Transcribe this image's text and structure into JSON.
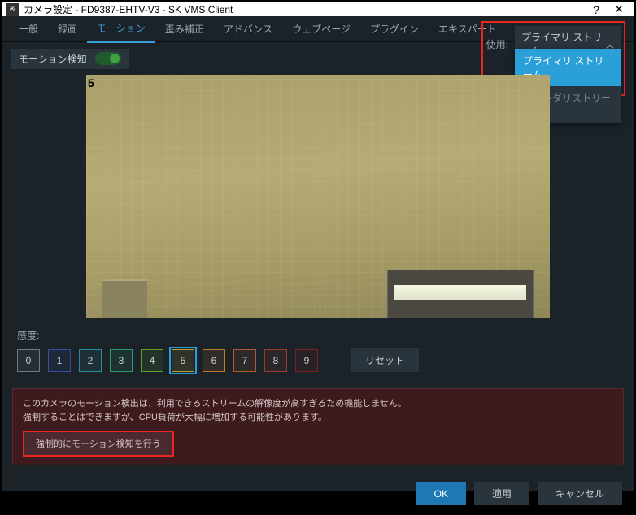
{
  "titlebar": {
    "icon_text": "※",
    "title": "カメラ設定 - FD9387-EHTV-V3 - SK VMS Client",
    "help": "?",
    "close": "✕"
  },
  "tabs": {
    "items": [
      "一般",
      "録画",
      "モーション",
      "歪み補正",
      "アドバンス",
      "ウェブページ",
      "プラグイン",
      "エキスパート"
    ],
    "active_index": 2
  },
  "toolbar": {
    "motion_label": "モーション検知",
    "use_label": "使用:",
    "dropdown": {
      "selected": "プライマリ ストリーム",
      "options": [
        "プライマリ ストリーム",
        "セカンダリストリーム"
      ]
    }
  },
  "preview": {
    "overlay_text": "5"
  },
  "sensitivity": {
    "label": "感度:",
    "values": [
      "0",
      "1",
      "2",
      "3",
      "4",
      "5",
      "6",
      "7",
      "8",
      "9"
    ],
    "colors": [
      "#6a7a87",
      "#3b4ba0",
      "#2a8aa0",
      "#2a9a6a",
      "#5aa02a",
      "#c0a030",
      "#c07a30",
      "#b05a30",
      "#9a3a30",
      "#802020"
    ],
    "selected_index": 5,
    "reset": "リセット"
  },
  "warning": {
    "line1": "このカメラのモーション検出は、利用できるストリームの解像度が高すぎるため機能しません。",
    "line2": "強制することはできますが、CPU負荷が大幅に増加する可能性があります。",
    "force_button": "強制的にモーション検知を行う"
  },
  "footer": {
    "ok": "OK",
    "apply": "適用",
    "cancel": "キャンセル"
  }
}
